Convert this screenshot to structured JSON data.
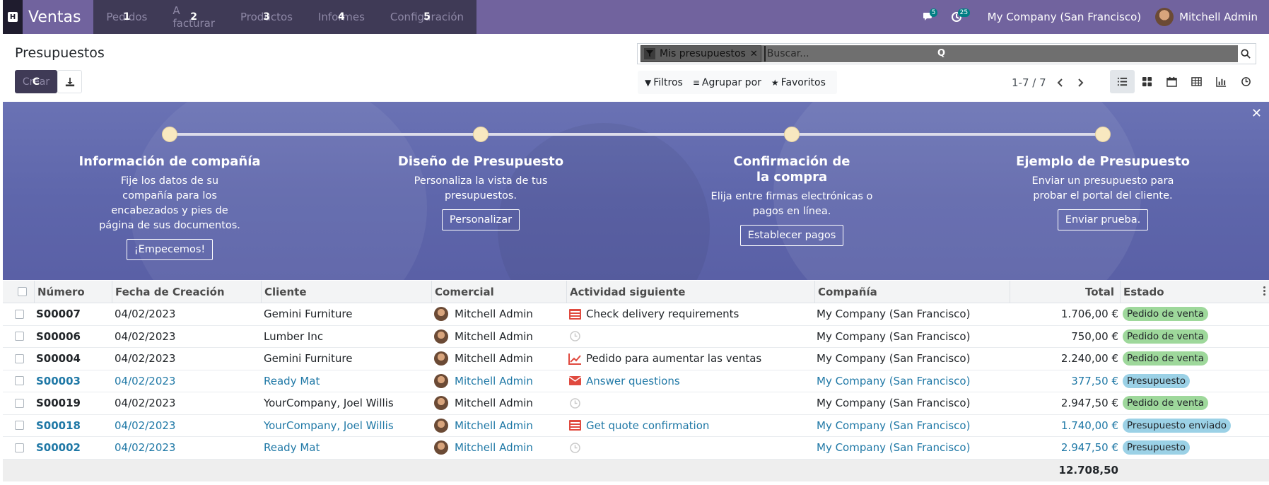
{
  "navbar": {
    "apps_icon": "apps-grid-icon",
    "brand": "Ventas",
    "menu": [
      {
        "label": "Pedidos",
        "badge": "1"
      },
      {
        "label": "A facturar",
        "badge": "2"
      },
      {
        "label": "Productos",
        "badge": "3"
      },
      {
        "label": "Informes",
        "badge": "4"
      },
      {
        "label": "Configuración",
        "badge": "5"
      }
    ],
    "messages_count": "5",
    "activities_count": "25",
    "company": "My Company (San Francisco)",
    "user": "Mitchell Admin"
  },
  "control": {
    "title": "Presupuestos",
    "create_label": "Crear",
    "create_badge": "C",
    "facet_label": "Mis presupuestos",
    "search_placeholder": "Buscar...",
    "search_shortcut": "Q",
    "filters_label": "Filtros",
    "group_label": "Agrupar por",
    "favorites_label": "Favoritos",
    "pager": "1-7 / 7"
  },
  "banner": {
    "steps": [
      {
        "title": "Información de compañía",
        "text": "Fije los datos de su compañía para los encabezados y pies de página de sus documentos.",
        "button": "¡Empecemos!"
      },
      {
        "title": "Diseño de Presupuesto",
        "text": "Personaliza la vista de tus presupuestos.",
        "button": "Personalizar"
      },
      {
        "title": "Confirmación de la compra",
        "text": "Elija entre firmas electrónicas o pagos en línea.",
        "button": "Establecer pagos"
      },
      {
        "title": "Ejemplo de Presupuesto",
        "text": "Enviar un presupuesto para probar el portal del cliente.",
        "button": "Enviar prueba."
      }
    ]
  },
  "table": {
    "headers": {
      "number": "Número",
      "date": "Fecha de Creación",
      "client": "Cliente",
      "salesperson": "Comercial",
      "activity": "Actividad siguiente",
      "company": "Compañía",
      "total": "Total",
      "state": "Estado"
    },
    "rows": [
      {
        "number": "S00007",
        "date": "04/02/2023",
        "client": "Gemini Furniture",
        "salesperson": "Mitchell Admin",
        "activity": "Check delivery requirements",
        "activity_icon": "task-list-icon",
        "company": "My Company (San Francisco)",
        "total": "1.706,00 €",
        "state": "Pedido de venta",
        "state_color": "green",
        "highlight": false
      },
      {
        "number": "S00006",
        "date": "04/02/2023",
        "client": "Lumber Inc",
        "salesperson": "Mitchell Admin",
        "activity": "",
        "activity_icon": "clock-icon",
        "company": "My Company (San Francisco)",
        "total": "750,00 €",
        "state": "Pedido de venta",
        "state_color": "green",
        "highlight": false
      },
      {
        "number": "S00004",
        "date": "04/02/2023",
        "client": "Gemini Furniture",
        "salesperson": "Mitchell Admin",
        "activity": "Pedido para aumentar las ventas",
        "activity_icon": "trend-up-icon",
        "company": "My Company (San Francisco)",
        "total": "2.240,00 €",
        "state": "Pedido de venta",
        "state_color": "green",
        "highlight": false
      },
      {
        "number": "S00003",
        "date": "04/02/2023",
        "client": "Ready Mat",
        "salesperson": "Mitchell Admin",
        "activity": "Answer questions",
        "activity_icon": "envelope-icon",
        "company": "My Company (San Francisco)",
        "total": "377,50 €",
        "state": "Presupuesto",
        "state_color": "blue",
        "highlight": true
      },
      {
        "number": "S00019",
        "date": "04/02/2023",
        "client": "YourCompany, Joel Willis",
        "salesperson": "Mitchell Admin",
        "activity": "",
        "activity_icon": "clock-icon",
        "company": "My Company (San Francisco)",
        "total": "2.947,50 €",
        "state": "Pedido de venta",
        "state_color": "green",
        "highlight": false
      },
      {
        "number": "S00018",
        "date": "04/02/2023",
        "client": "YourCompany, Joel Willis",
        "salesperson": "Mitchell Admin",
        "activity": "Get quote confirmation",
        "activity_icon": "task-list-icon",
        "company": "My Company (San Francisco)",
        "total": "1.740,00 €",
        "state": "Presupuesto enviado",
        "state_color": "blue",
        "highlight": true
      },
      {
        "number": "S00002",
        "date": "04/02/2023",
        "client": "Ready Mat",
        "salesperson": "Mitchell Admin",
        "activity": "",
        "activity_icon": "clock-icon",
        "company": "My Company (San Francisco)",
        "total": "2.947,50 €",
        "state": "Presupuesto",
        "state_color": "blue",
        "highlight": true
      }
    ],
    "sum_total": "12.708,50"
  },
  "colors": {
    "navbar": "#71639e",
    "navbar_dark": "#3f3a56",
    "link": "#1f78a6",
    "badge_green": "#9ed89b",
    "badge_blue": "#9bd1e6"
  }
}
